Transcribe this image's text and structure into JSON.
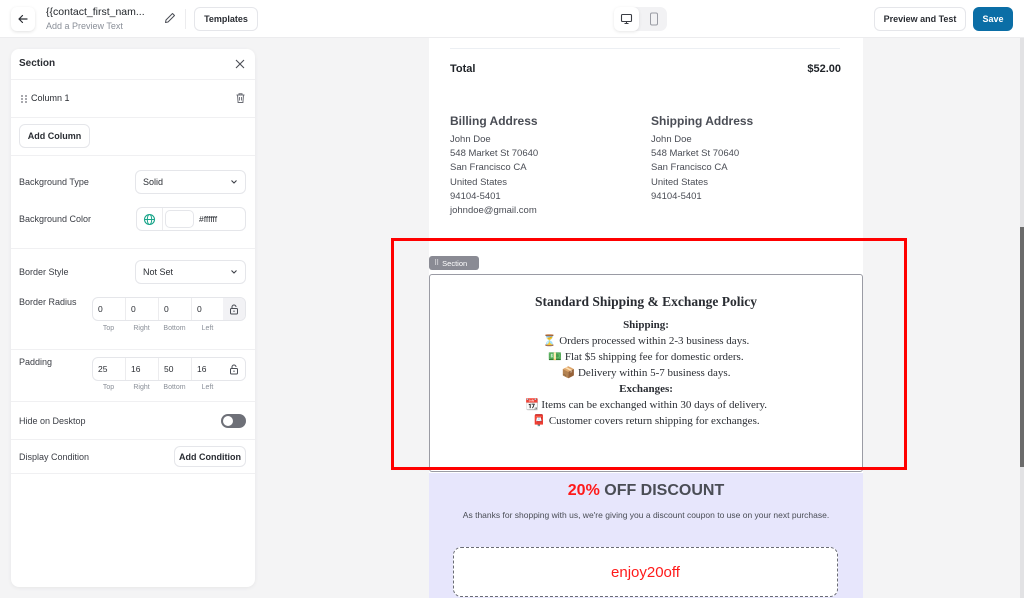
{
  "topbar": {
    "title": "{{contact_first_nam...",
    "subtitle": "Add a Preview Text",
    "templates_label": "Templates",
    "preview_label": "Preview and Test",
    "save_label": "Save",
    "device_selected": "desktop"
  },
  "panel": {
    "title": "Section",
    "column_label": "Column 1",
    "add_column_label": "Add Column",
    "background_type": {
      "label": "Background Type",
      "value": "Solid"
    },
    "background_color": {
      "label": "Background Color",
      "value": "#ffffff"
    },
    "border_style": {
      "label": "Border Style",
      "value": "Not Set"
    },
    "border_radius": {
      "label": "Border Radius",
      "values": [
        "0",
        "0",
        "0",
        "0"
      ],
      "sides": [
        "Top",
        "Right",
        "Bottom",
        "Left"
      ]
    },
    "padding": {
      "label": "Padding",
      "values": [
        "25",
        "16",
        "50",
        "16"
      ],
      "sides": [
        "Top",
        "Right",
        "Bottom",
        "Left"
      ]
    },
    "hide_on_desktop": {
      "label": "Hide on Desktop",
      "enabled": false
    },
    "display_condition": {
      "label": "Display Condition",
      "button": "Add Condition"
    }
  },
  "email": {
    "total_label": "Total",
    "total_value": "$52.00",
    "billing": {
      "heading": "Billing Address",
      "lines": [
        "John Doe",
        "548 Market St 70640",
        "San Francisco CA",
        "United States",
        "94104-5401",
        "johndoe@gmail.com"
      ]
    },
    "shipping": {
      "heading": "Shipping Address",
      "lines": [
        "John Doe",
        "548 Market St 70640",
        "San Francisco CA",
        "United States",
        "94104-5401"
      ]
    },
    "section_tag": "Section",
    "policy": {
      "title": "Standard Shipping & Exchange Policy",
      "shipping_heading": "Shipping:",
      "shipping_lines": [
        "⏳ Orders processed within 2-3 business days.",
        "💵 Flat $5 shipping fee for domestic orders.",
        "📦 Delivery within 5-7 business days."
      ],
      "exchanges_heading": "Exchanges:",
      "exchange_lines": [
        "📆 Items can be exchanged within 30 days of delivery.",
        "📮 Customer covers return shipping for exchanges."
      ]
    },
    "discount": {
      "percent": "20%",
      "title_rest": " OFF DISCOUNT",
      "text": "As thanks for shopping with us, we're giving you a discount coupon to use on your next purchase.",
      "code": "enjoy20off"
    }
  },
  "colors": {
    "save_button": "#0b6ea6",
    "highlight_outline": "#ff0000",
    "discount_bg": "#e7e6fc",
    "discount_accent": "#ff1a1a"
  }
}
